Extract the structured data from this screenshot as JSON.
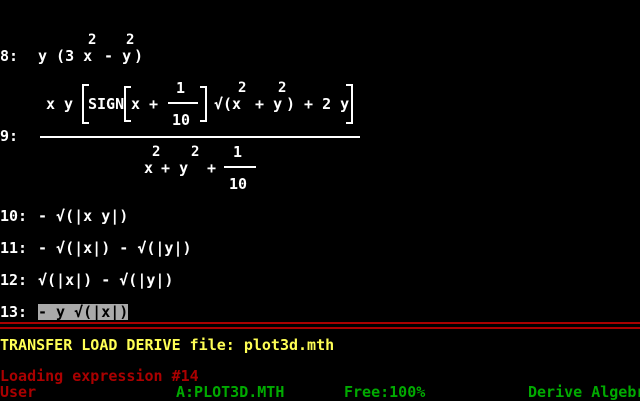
{
  "expressions": {
    "e8": {
      "label": "8:",
      "pre": "y (3 x",
      "exp1": "2",
      "mid": " - y",
      "exp2": "2",
      "post": ")"
    },
    "e9": {
      "label": "9:",
      "num_a": "x y ",
      "sign": "SIGN ",
      "x_plus": "x + ",
      "one": "1",
      "ten": "10",
      "sqrt_part": "√(x",
      "num_exp1": "2",
      "num_plus_y": " + y",
      "num_exp2": "2",
      "num_tail": ") + 2 y",
      "den_x": "x",
      "den_exp1": "2",
      "den_plus_y": " + y",
      "den_exp2": "2",
      "den_plus": " + ",
      "den_one": "1",
      "den_ten": "10"
    },
    "e10": {
      "label": "10:",
      "text": "- √(|x y|)"
    },
    "e11": {
      "label": "11:",
      "text": "- √(|x|) - √(|y|)"
    },
    "e12": {
      "label": "12:",
      "text": "√(|x|) - √(|y|)"
    },
    "e13": {
      "label": "13:",
      "text": "- y √(|x|)"
    }
  },
  "command_line": {
    "menu": "TRANSFER LOAD DERIVE file: plot3d.mth"
  },
  "message": "Loading expression #14",
  "status_bar": {
    "mode": "User",
    "file": "A:PLOT3D.MTH",
    "free": "Free:100%",
    "app": "Derive Algebra"
  },
  "colors": {
    "background": "#000000",
    "text": "#ffffff",
    "menu": "#ffff55",
    "separator": "#aa0000",
    "message": "#aa0000",
    "status": "#00aa00",
    "highlight": "#aaaaaa"
  }
}
